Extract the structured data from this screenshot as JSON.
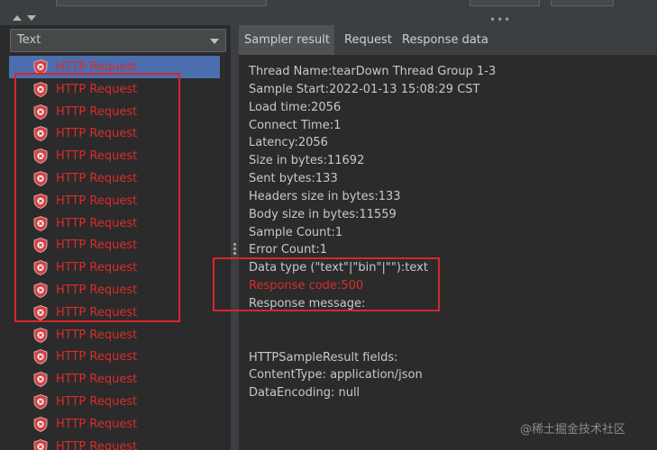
{
  "view_select": {
    "value": "Text"
  },
  "tree": {
    "items": [
      {
        "label": "HTTP Request",
        "selected": true
      },
      {
        "label": "HTTP Request"
      },
      {
        "label": "HTTP Request"
      },
      {
        "label": "HTTP Request"
      },
      {
        "label": "HTTP Request"
      },
      {
        "label": "HTTP Request"
      },
      {
        "label": "HTTP Request"
      },
      {
        "label": "HTTP Request"
      },
      {
        "label": "HTTP Request"
      },
      {
        "label": "HTTP Request"
      },
      {
        "label": "HTTP Request"
      },
      {
        "label": "HTTP Request"
      },
      {
        "label": "HTTP Request"
      },
      {
        "label": "HTTP Request"
      },
      {
        "label": "HTTP Request"
      },
      {
        "label": "HTTP Request"
      },
      {
        "label": "HTTP Request"
      },
      {
        "label": "HTTP Request"
      }
    ],
    "icon": "error-shield-icon"
  },
  "tabs": [
    {
      "label": "Sampler result",
      "active": true
    },
    {
      "label": "Request"
    },
    {
      "label": "Response data"
    }
  ],
  "sampler_result": {
    "lines": [
      "Thread Name:tearDown Thread Group 1-3",
      "Sample Start:2022-01-13 15:08:29 CST",
      "Load time:2056",
      "Connect Time:1",
      "Latency:2056",
      "Size in bytes:11692",
      "Sent bytes:133",
      "Headers size in bytes:133",
      "Body size in bytes:11559",
      "Sample Count:1",
      "Error Count:1",
      "Data type (\"text\"|\"bin\"|\"\"):text",
      "Response code:500",
      "Response message:",
      "",
      "",
      "HTTPSampleResult fields:",
      "ContentType: application/json",
      "DataEncoding: null"
    ],
    "error_line": "Response code:500"
  },
  "colors": {
    "error": "#d92c2c",
    "selection": "#4b6eaf",
    "highlight_box": "#d8262a"
  },
  "watermark": "@稀土掘金技术社区"
}
